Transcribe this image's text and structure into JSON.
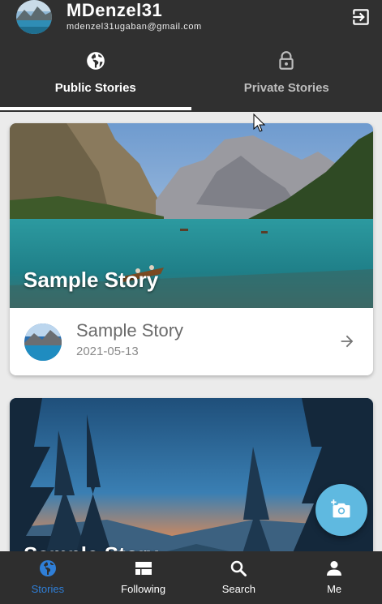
{
  "user": {
    "name": "MDenzel31",
    "email": "mdenzel31ugaban@gmail.com"
  },
  "tabs": [
    {
      "label": "Public Stories",
      "icon": "globe-icon",
      "active": true
    },
    {
      "label": "Private Stories",
      "icon": "lock-icon",
      "active": false
    }
  ],
  "stories": [
    {
      "overlay_title": "Sample Story",
      "title": "Sample Story",
      "date": "2021-05-13",
      "image": "mountain-lake-photo"
    },
    {
      "overlay_title": "Sample Story",
      "image": "forest-sunset-illustration"
    }
  ],
  "fab": {
    "icon": "add-photo-icon"
  },
  "bottom_nav": [
    {
      "label": "Stories",
      "icon": "globe-icon",
      "active": true
    },
    {
      "label": "Following",
      "icon": "view-list-icon",
      "active": false
    },
    {
      "label": "Search",
      "icon": "search-icon",
      "active": false
    },
    {
      "label": "Me",
      "icon": "person-icon",
      "active": false
    }
  ],
  "colors": {
    "appbar": "#303030",
    "bottom_nav": "#2e2e2e",
    "accent": "#2f7fd8",
    "fab": "#5fb9e0"
  }
}
